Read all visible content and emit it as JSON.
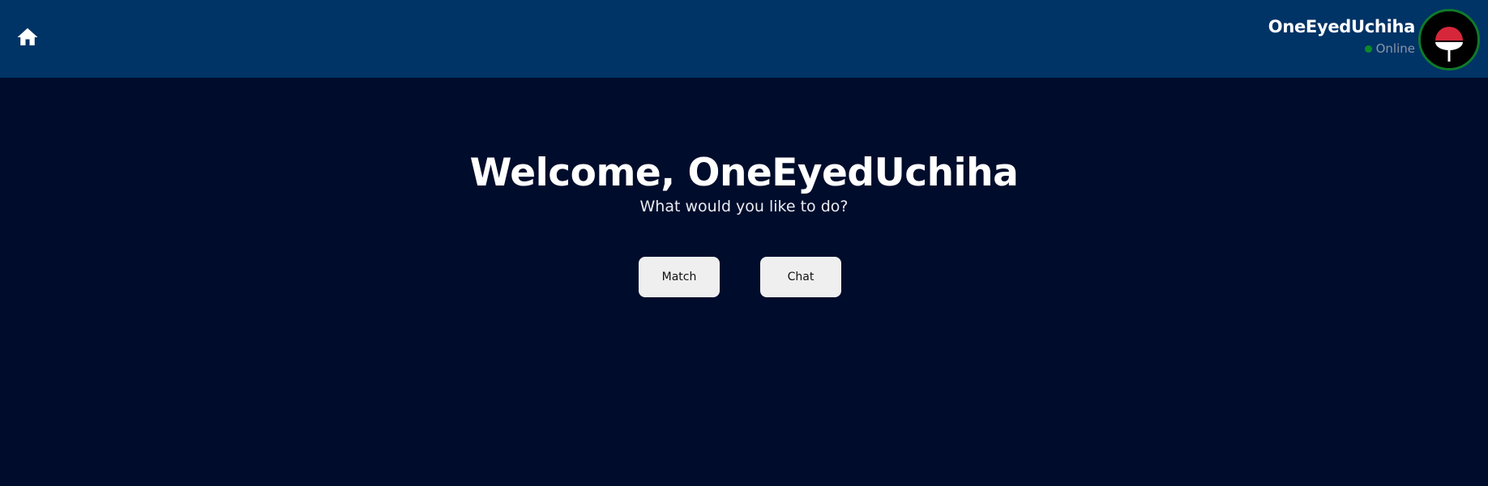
{
  "header": {
    "home_icon": "home-icon",
    "username": "OneEyedUchiha",
    "status": "Online",
    "status_color": "#0b8a2a",
    "avatar_icon": "uchiha-clan-icon",
    "background_color": "#003366"
  },
  "main": {
    "welcome_prefix": "Welcome, ",
    "welcome_name": "OneEyedUchiha",
    "subtitle": "What would you like to do?",
    "background_color": "#000c2b",
    "actions": [
      {
        "label": "Match"
      },
      {
        "label": "Chat"
      }
    ]
  }
}
